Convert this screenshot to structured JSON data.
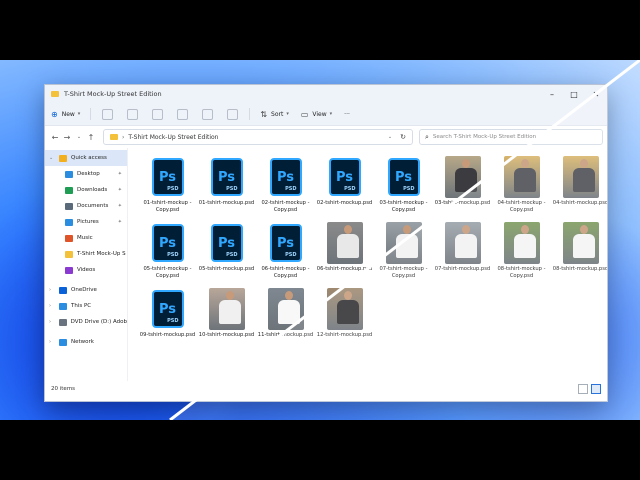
{
  "window": {
    "title": "T-Shirt Mock-Up Street Edition"
  },
  "toolbar": {
    "new_label": "New",
    "sort_label": "Sort",
    "view_label": "View",
    "more_label": "···"
  },
  "address": {
    "path": "T-Shirt Mock-Up Street Edition",
    "search_placeholder": "Search T-Shirt Mock-Up Street Edition"
  },
  "sidebar": {
    "items": [
      {
        "label": "Quick access",
        "icon": "star-icon",
        "color": "#f2b01e"
      },
      {
        "label": "Desktop",
        "icon": "desktop-icon",
        "color": "#2a8de0"
      },
      {
        "label": "Downloads",
        "icon": "download-icon",
        "color": "#1f9d55"
      },
      {
        "label": "Documents",
        "icon": "document-icon",
        "color": "#5a6a7a"
      },
      {
        "label": "Pictures",
        "icon": "picture-icon",
        "color": "#2a8de0"
      },
      {
        "label": "Music",
        "icon": "music-icon",
        "color": "#e0542a"
      },
      {
        "label": "T-Shirt Mock-Up S",
        "icon": "folder-icon",
        "color": "#f3c13a"
      },
      {
        "label": "Videos",
        "icon": "video-icon",
        "color": "#8a3ad0"
      },
      {
        "label": "OneDrive",
        "icon": "cloud-icon",
        "color": "#0b61d8"
      },
      {
        "label": "This PC",
        "icon": "computer-icon",
        "color": "#2a8de0"
      },
      {
        "label": "DVD Drive (D:) Adob",
        "icon": "disc-icon",
        "color": "#6a7480"
      },
      {
        "label": "Network",
        "icon": "network-icon",
        "color": "#2a8de0"
      }
    ]
  },
  "files": [
    {
      "name": "01-tshirt-mockup - Copy.psd",
      "kind": "psd"
    },
    {
      "name": "01-tshirt-mockup.psd",
      "kind": "psd"
    },
    {
      "name": "02-tshirt-mockup - Copy.psd",
      "kind": "psd"
    },
    {
      "name": "02-tshirt-mockup.psd",
      "kind": "psd"
    },
    {
      "name": "03-tshirt-mockup - Copy.psd",
      "kind": "psd"
    },
    {
      "name": "03-tshirt-mockup.psd",
      "kind": "photo",
      "shirt": "#3b3b40",
      "bg": "#b7a888"
    },
    {
      "name": "04-tshirt-mockup - Copy.psd",
      "kind": "photo",
      "shirt": "#4a4a52",
      "bg": "#d9b56a"
    },
    {
      "name": "04-tshirt-mockup.psd",
      "kind": "photo",
      "shirt": "#4a4a52",
      "bg": "#d9b56a"
    },
    {
      "name": "05-tshirt-mockup - Copy.psd",
      "kind": "psd"
    },
    {
      "name": "05-tshirt-mockup.psd",
      "kind": "psd"
    },
    {
      "name": "06-tshirt-mockup - Copy.psd",
      "kind": "psd"
    },
    {
      "name": "06-tshirt-mockup.psd",
      "kind": "photo",
      "shirt": "#e8e8e8",
      "bg": "#8a8a8a"
    },
    {
      "name": "07-tshirt-mockup - Copy.psd",
      "kind": "photo",
      "shirt": "#f2f2f2",
      "bg": "#9aa2a8"
    },
    {
      "name": "07-tshirt-mockup.psd",
      "kind": "photo",
      "shirt": "#f2f2f2",
      "bg": "#9aa2a8"
    },
    {
      "name": "08-tshirt-mockup - Copy.psd",
      "kind": "photo",
      "shirt": "#f4f4f4",
      "bg": "#7c9a5a"
    },
    {
      "name": "08-tshirt-mockup.psd",
      "kind": "photo",
      "shirt": "#f4f4f4",
      "bg": "#7c9a5a"
    },
    {
      "name": "09-tshirt-mockup.psd",
      "kind": "psd"
    },
    {
      "name": "10-tshirt-mockup.psd",
      "kind": "photo",
      "shirt": "#f0f0f0",
      "bg": "#b9a79a"
    },
    {
      "name": "11-tshirt-mockup.psd",
      "kind": "photo",
      "shirt": "#f8f8f8",
      "bg": "#7f8891"
    },
    {
      "name": "12-tshirt-mockup.psd",
      "kind": "photo",
      "shirt": "#2f2f33",
      "bg": "#a08a70"
    }
  ],
  "status": {
    "count": "20 items"
  },
  "psd_icon": {
    "glyph": "Ps",
    "sub": "PSD"
  }
}
